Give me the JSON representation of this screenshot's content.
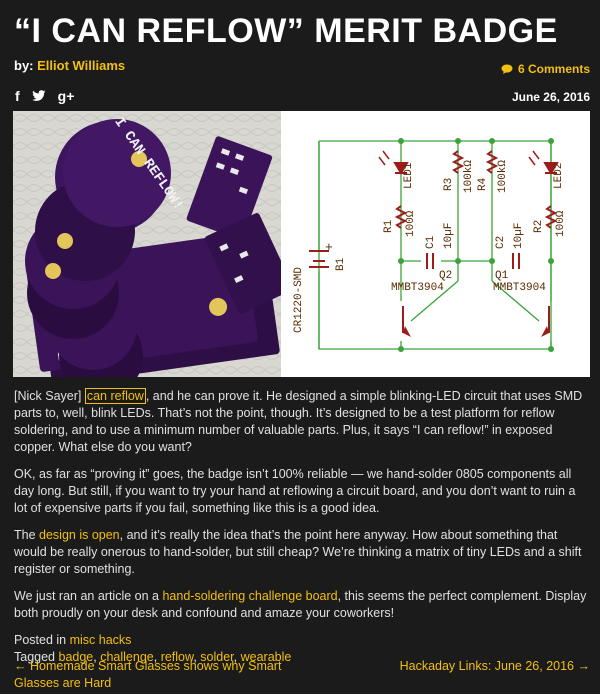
{
  "article": {
    "title": "“I CAN REFLOW” MERIT BADGE",
    "by_prefix": "by:",
    "author": "Elliot Williams",
    "comments": "6 Comments",
    "date": "June 26, 2016",
    "social": {
      "facebook": "f",
      "twitter": "t",
      "google": "g+"
    }
  },
  "schematic": {
    "labels": {
      "led1": "LED1",
      "led2": "LED2",
      "r1": "R1",
      "r1v": "100Ω",
      "r2": "R2",
      "r2v": "100Ω",
      "r3": "R3",
      "r3v": "100kΩ",
      "r4": "R4",
      "r4v": "100kΩ",
      "c1": "C1",
      "c1v": "10µF",
      "c2": "C2",
      "c2v": "10µF",
      "q1": "Q1",
      "q1v": "MMBT3904",
      "q2": "Q2",
      "q2v": "MMBT3904",
      "b1": "B1",
      "b1v": "CR1220-SMD",
      "plus": "+"
    }
  },
  "photo": {
    "badge_text": "I CAN REFLOW!"
  },
  "paragraphs": {
    "p1_pre": "[Nick Sayer] ",
    "p1_link": "can reflow",
    "p1_post": ", and he can prove it. He designed a simple blinking-LED circuit that uses SMD parts to, well, blink LEDs. That’s not the point, though. It’s designed to be a test platform for reflow soldering, and to use a minimum number of valuable parts. Plus, it says “I can reflow!” in exposed copper. What else do you want?",
    "p2": "OK, as far as “proving it” goes, the badge isn’t 100% reliable — we hand-solder 0805 components all day long. But still, if you want to try your hand at reflowing a circuit board, and you don’t want to ruin a lot of expensive parts if you fail, something like this is a good idea.",
    "p3_pre": "The ",
    "p3_link": "design is open",
    "p3_post": ", and it’s really the idea that’s the point here anyway. How about something that would be really onerous to hand-solder, but still cheap? We’re thinking a matrix of tiny LEDs and a shift register or something.",
    "p4_pre": "We just ran an article on a ",
    "p4_link": "hand-soldering challenge board",
    "p4_post": ", this seems the perfect complement. Display both proudly on your desk and confound and amaze your coworkers!"
  },
  "meta": {
    "posted_in": "Posted in",
    "category": "misc hacks",
    "tagged": "Tagged",
    "tags": [
      "badge",
      "challenge",
      "reflow",
      "solder",
      "wearable"
    ]
  },
  "nav": {
    "prev": "← Homemade Smart Glasses shows why Smart Glasses are Hard",
    "next": "Hackaday Links: June 26, 2016 →"
  },
  "colors": {
    "accent": "#f3bf10",
    "background": "#1b1b1b",
    "pcb": "#3a1358",
    "wire": "#3aa33a"
  }
}
